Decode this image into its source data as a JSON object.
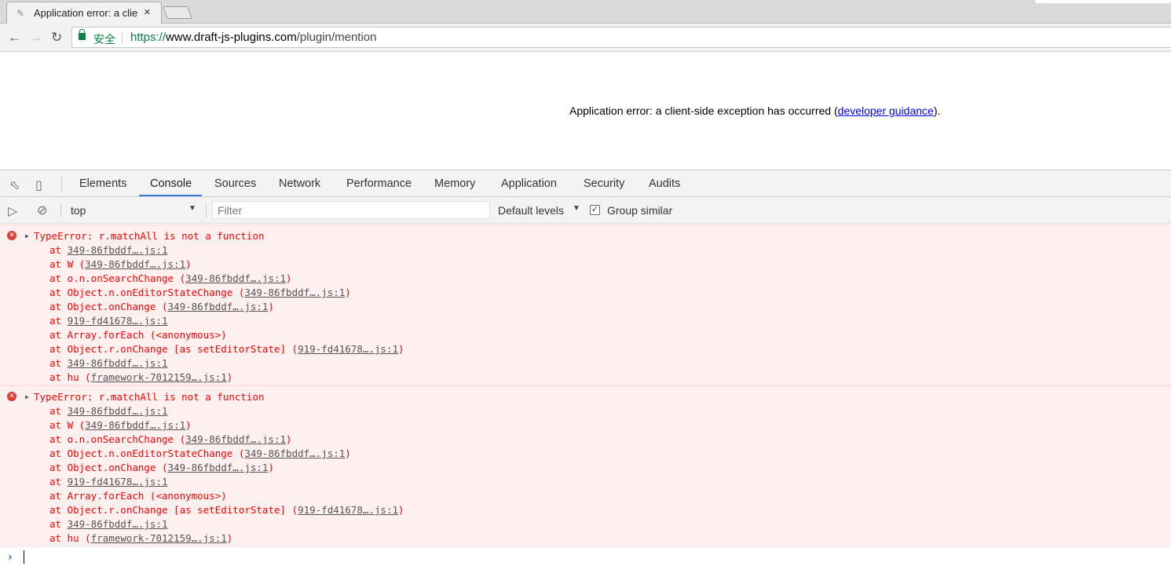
{
  "browser": {
    "tab_title": "Application error: a clie",
    "close_glyph": "×",
    "secure_label": "安全",
    "url_scheme": "https://",
    "url_host": "www.draft-js-plugins.com",
    "url_path": "/plugin/mention"
  },
  "page": {
    "error_text": "Application error: a client-side exception has occurred (",
    "link_text": "developer guidance",
    "error_tail": ")."
  },
  "devtools": {
    "tabs": [
      "Elements",
      "Console",
      "Sources",
      "Network",
      "Performance",
      "Memory",
      "Application",
      "Security",
      "Audits"
    ],
    "active_tab": "Console",
    "context": "top",
    "filter_placeholder": "Filter",
    "levels_label": "Default levels",
    "group_similar_label": "Group similar",
    "group_similar_checked": true
  },
  "console": {
    "errors": [
      {
        "message": "TypeError: r.matchAll is not a function",
        "stack": [
          {
            "pre": "at ",
            "link": "349-86fbddf….js:1",
            "post": ""
          },
          {
            "pre": "at W (",
            "link": "349-86fbddf….js:1",
            "post": ")"
          },
          {
            "pre": "at o.n.onSearchChange (",
            "link": "349-86fbddf….js:1",
            "post": ")"
          },
          {
            "pre": "at Object.n.onEditorStateChange (",
            "link": "349-86fbddf….js:1",
            "post": ")"
          },
          {
            "pre": "at Object.onChange (",
            "link": "349-86fbddf….js:1",
            "post": ")"
          },
          {
            "pre": "at ",
            "link": "919-fd41678….js:1",
            "post": ""
          },
          {
            "pre": "at Array.forEach (<anonymous>)",
            "link": "",
            "post": ""
          },
          {
            "pre": "at Object.r.onChange [as setEditorState] (",
            "link": "919-fd41678….js:1",
            "post": ")"
          },
          {
            "pre": "at ",
            "link": "349-86fbddf….js:1",
            "post": ""
          },
          {
            "pre": "at hu (",
            "link": "framework-7012159….js:1",
            "post": ")"
          }
        ]
      },
      {
        "message": "TypeError: r.matchAll is not a function",
        "stack": [
          {
            "pre": "at ",
            "link": "349-86fbddf….js:1",
            "post": ""
          },
          {
            "pre": "at W (",
            "link": "349-86fbddf….js:1",
            "post": ")"
          },
          {
            "pre": "at o.n.onSearchChange (",
            "link": "349-86fbddf….js:1",
            "post": ")"
          },
          {
            "pre": "at Object.n.onEditorStateChange (",
            "link": "349-86fbddf….js:1",
            "post": ")"
          },
          {
            "pre": "at Object.onChange (",
            "link": "349-86fbddf….js:1",
            "post": ")"
          },
          {
            "pre": "at ",
            "link": "919-fd41678….js:1",
            "post": ""
          },
          {
            "pre": "at Array.forEach (<anonymous>)",
            "link": "",
            "post": ""
          },
          {
            "pre": "at Object.r.onChange [as setEditorState] (",
            "link": "919-fd41678….js:1",
            "post": ")"
          },
          {
            "pre": "at ",
            "link": "349-86fbddf….js:1",
            "post": ""
          },
          {
            "pre": "at hu (",
            "link": "framework-7012159….js:1",
            "post": ")"
          }
        ]
      }
    ],
    "prompt_glyph": "›"
  },
  "icons": [
    "favicon-icon",
    "back-icon",
    "forward-icon",
    "reload-icon",
    "lock-icon",
    "inspect-icon",
    "device-icon",
    "sidebar-icon",
    "clear-console-icon",
    "error-icon",
    "expand-triangle-icon"
  ],
  "colors": {
    "error_red": "#ff0000",
    "error_bg": "#fff0f0",
    "secure_green": "#0b8043",
    "active_tab_blue": "#3879d9"
  }
}
